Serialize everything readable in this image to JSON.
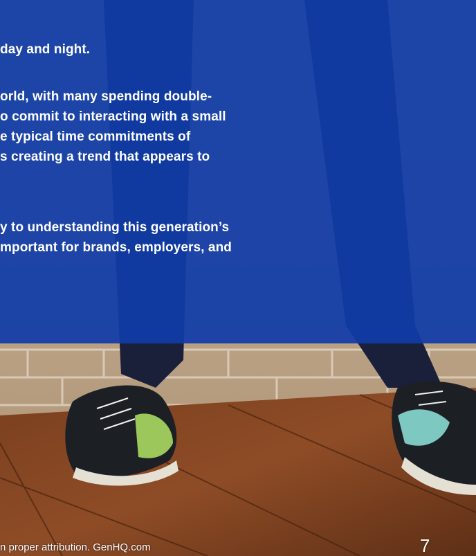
{
  "body": {
    "paragraph_1": [
      "day and night."
    ],
    "paragraph_2": [
      "orld, with many spending double-",
      "o commit to interacting with a small",
      "e typical time commitments of",
      "s creating a trend that appears to"
    ],
    "paragraph_3": [
      "y to understanding this generation’s",
      "mportant for brands, employers, and"
    ]
  },
  "footer": {
    "credit": "n proper attribution. GenHQ.com",
    "page_number": "7"
  },
  "colors": {
    "overlay_blue": "#103ca8",
    "text": "#ffffff"
  }
}
